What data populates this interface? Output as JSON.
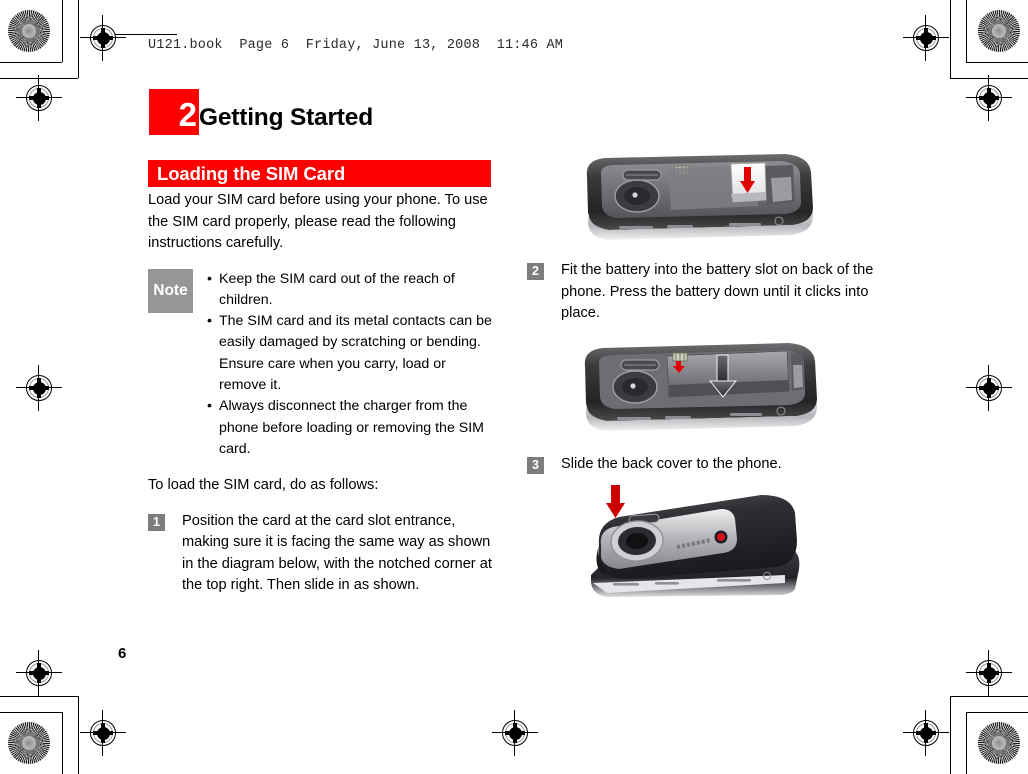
{
  "document": {
    "file_header": "U121.book  Page 6  Friday, June 13, 2008  11:46 AM",
    "page_number": "6",
    "chapter_number": "2",
    "chapter_title": "Getting Started",
    "section_title": "Loading the SIM Card",
    "intro_paragraph": "Load your SIM card before using your phone. To use the SIM card properly, please read the following instructions carefully.",
    "note": {
      "label": "Note",
      "bullet_char": "•",
      "items": [
        "Keep the SIM card out of the reach of children.",
        "The SIM card and its metal contacts can be easily damaged by scratching or bending. Ensure care when you carry, load or remove it.",
        "Always disconnect the charger from the phone before loading or removing the SIM card."
      ]
    },
    "lead_in": "To load the SIM card, do as follows:",
    "steps": [
      {
        "number": "1",
        "text": "Position the card at the card slot entrance, making sure it is facing the same way as shown in the diagram below, with the notched corner at the top right. Then slide in as shown."
      },
      {
        "number": "2",
        "text": "Fit the battery into the battery slot on back of the phone. Press the battery down until it clicks into place."
      },
      {
        "number": "3",
        "text": "Slide the back cover to the phone."
      }
    ],
    "figures": [
      {
        "name": "sim-card-insertion-diagram",
        "caption": ""
      },
      {
        "name": "battery-insertion-diagram",
        "caption": ""
      },
      {
        "name": "back-cover-slide-diagram",
        "caption": ""
      }
    ]
  },
  "colors": {
    "brand_red": "#FF0000",
    "note_gray": "#969696",
    "step_gray": "#7D7D7D",
    "text_black": "#000000"
  },
  "print_marks": {
    "registration_mark_label": "registration-mark",
    "color_target_label": "color-calibration-target"
  }
}
